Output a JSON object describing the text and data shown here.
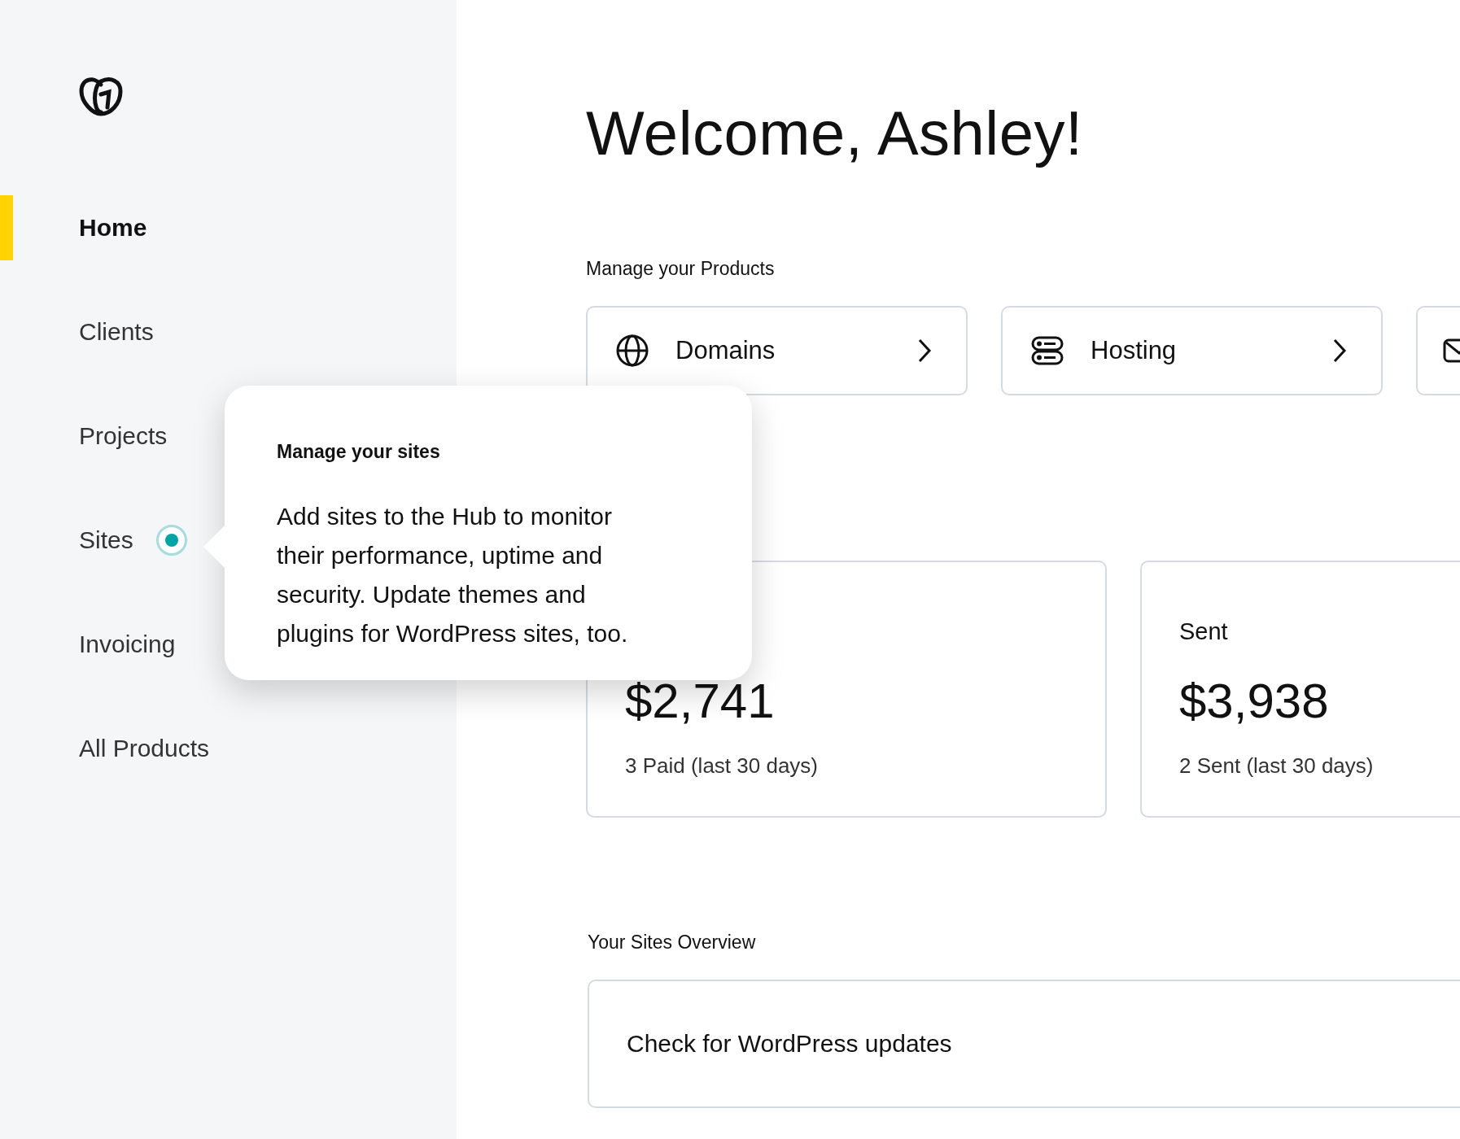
{
  "sidebar": {
    "items": [
      {
        "label": "Home",
        "selected": true,
        "beacon": false
      },
      {
        "label": "Clients",
        "selected": false,
        "beacon": false
      },
      {
        "label": "Projects",
        "selected": false,
        "beacon": false
      },
      {
        "label": "Sites",
        "selected": false,
        "beacon": true
      },
      {
        "label": "Invoicing",
        "selected": false,
        "beacon": false
      },
      {
        "label": "All Products",
        "selected": false,
        "beacon": false
      }
    ]
  },
  "greeting": "Welcome, Ashley!",
  "products": {
    "heading": "Manage your Products",
    "items": [
      {
        "kind": "domains",
        "label": "Domains"
      },
      {
        "kind": "hosting",
        "label": "Hosting"
      },
      {
        "kind": "email"
      }
    ]
  },
  "invoices": [
    {
      "amount": "$2,741",
      "caption": "3 Paid (last 30 days)"
    },
    {
      "label": "Sent",
      "amount": "$3,938",
      "caption": "2 Sent (last 30 days)"
    }
  ],
  "sites_overview": {
    "heading": "Your Sites Overview",
    "item": "Check for WordPress updates"
  },
  "tooltip": {
    "title": "Manage your sites",
    "body": "Add sites to the Hub to monitor their performance, uptime and security. Update themes and plugins for WordPress sites, too."
  }
}
